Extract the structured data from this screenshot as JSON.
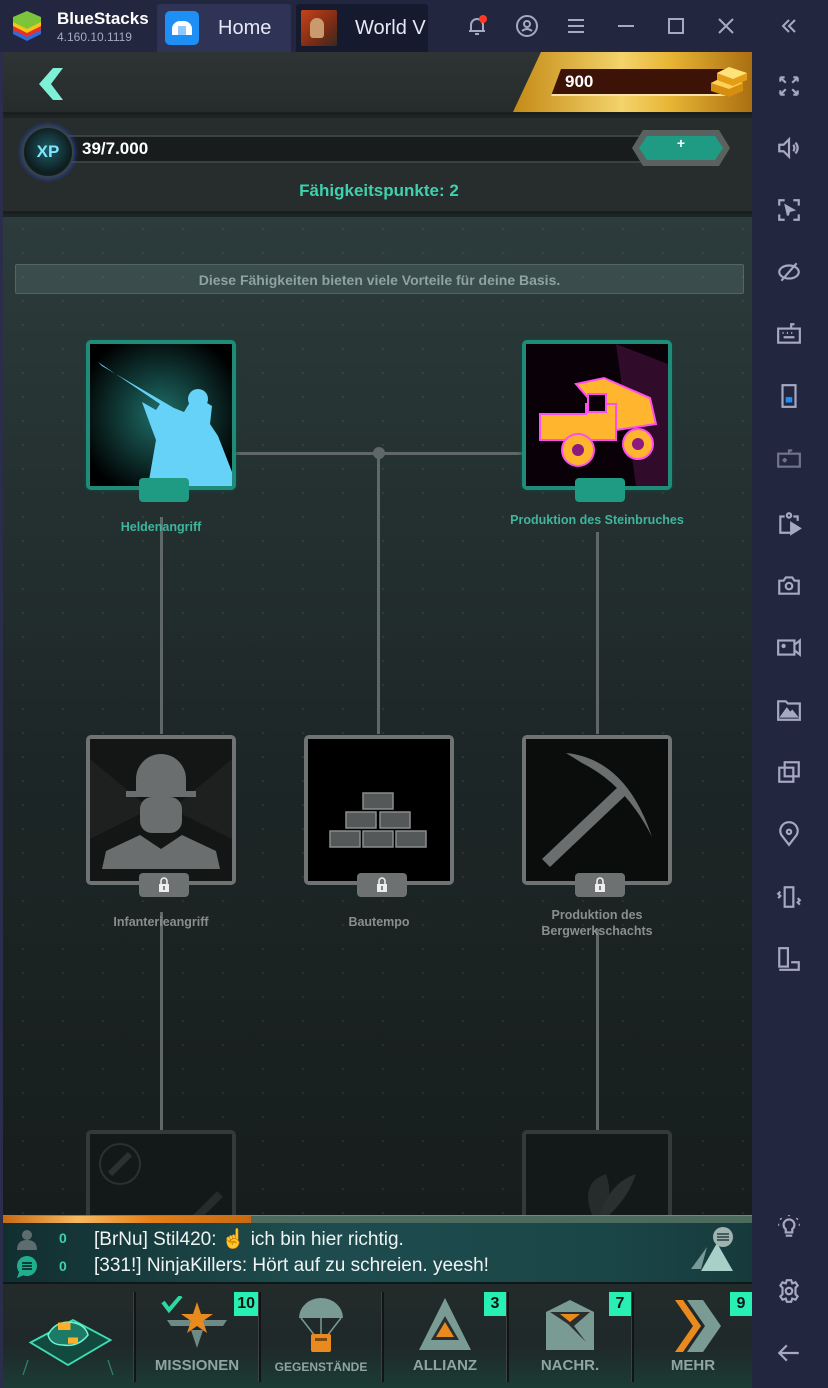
{
  "titlebar": {
    "app_name": "BlueStacks",
    "version": "4.160.10.1119",
    "tabs": [
      {
        "label": "Home",
        "icon": "home-icon"
      },
      {
        "label": "World V",
        "icon": "game-icon"
      }
    ],
    "controls": [
      "bell-icon",
      "account-icon",
      "menu-icon",
      "minimize-icon",
      "maximize-icon",
      "close-icon",
      "collapse-sidebar-icon"
    ]
  },
  "sidebar": {
    "icons": [
      "fullscreen-icon",
      "volume-icon",
      "pointer-lock-icon",
      "eye-off-icon",
      "keyboard-icon",
      "portrait-icon",
      "gamepad-icon",
      "media-manager-icon",
      "camera-icon",
      "record-icon",
      "gallery-icon",
      "multi-instance-icon",
      "location-icon",
      "shake-icon",
      "rotate-icon",
      "bulb-icon",
      "settings-icon",
      "back-icon"
    ]
  },
  "header": {
    "gold": "900",
    "xp_text": "39/7.000",
    "xp_badge": "XP",
    "xp_progress": 0.0056,
    "plus_label": "+",
    "skill_points": "Fähigkeitspunkte: 2"
  },
  "tree": {
    "banner": "Diese Fähigkeiten bieten viele Vorteile für deine Basis.",
    "skills": [
      {
        "name": "Heldenangriff",
        "state": "unlocked"
      },
      {
        "name": "Produktion des Steinbruches",
        "state": "unlocked"
      },
      {
        "name": "Infanterieangriff",
        "state": "locked"
      },
      {
        "name": "Bautempo",
        "state": "locked"
      },
      {
        "name": "Produktion des Bergwerkschachts",
        "state": "locked"
      }
    ]
  },
  "progress_strip": {
    "value": 0.33
  },
  "chat": {
    "rows": [
      {
        "icon": "user-icon",
        "count": "0",
        "message": "[BrNu] Stil420: ☝ ich bin hier richtig."
      },
      {
        "icon": "chat-bubble-icon",
        "count": "0",
        "message": "[331!] NinjaKillers: Hört auf zu schreien. yeesh!"
      }
    ]
  },
  "bottom_nav": {
    "items": [
      {
        "label": "",
        "icon": "base-map-icon",
        "badge": null
      },
      {
        "label": "MISSIONEN",
        "icon": "missions-icon",
        "badge": "10"
      },
      {
        "label": "GEGENSTÄNDE",
        "icon": "supply-drop-icon",
        "badge": null
      },
      {
        "label": "ALLIANZ",
        "icon": "alliance-icon",
        "badge": "3"
      },
      {
        "label": "NACHR.",
        "icon": "mail-icon",
        "badge": "7"
      },
      {
        "label": "MEHR",
        "icon": "more-icon",
        "badge": "9"
      }
    ]
  },
  "colors": {
    "accent_teal": "#3fd1ae",
    "badge_green": "#28f0b4",
    "gold": "#e7b534",
    "titlebar_bg": "#23263f"
  }
}
